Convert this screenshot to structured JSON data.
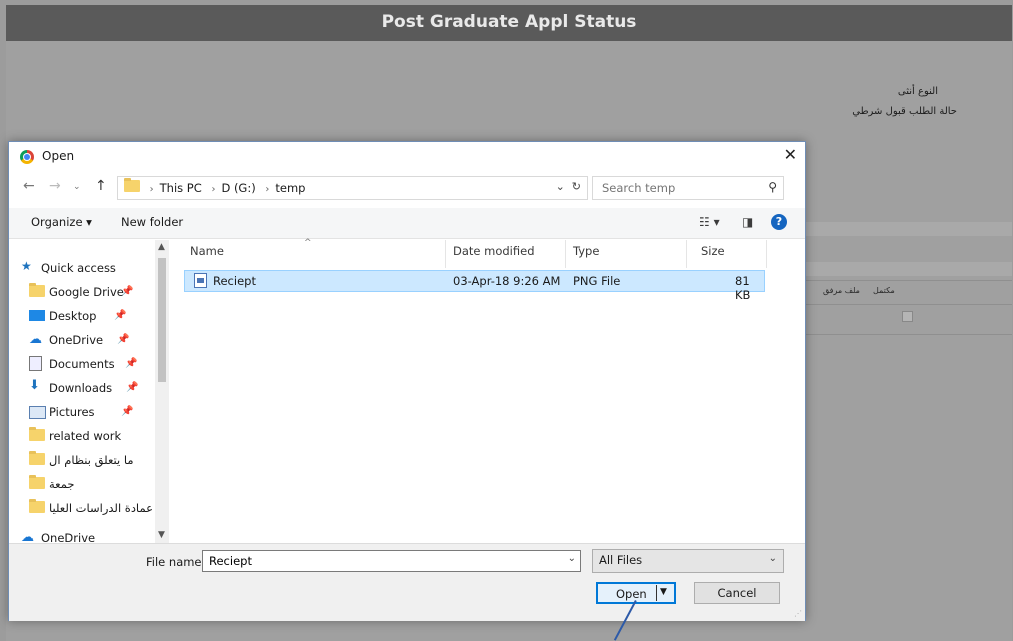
{
  "page": {
    "header_title": "Post Graduate Appl Status",
    "label_gender": "النوع أنثى",
    "label_request_status": "حالة الطلب قبول شرطي",
    "col_attached_file": "ملف مرفق",
    "col_complete": "مكتمل"
  },
  "dialog": {
    "title": "Open",
    "close_symbol": "✕",
    "breadcrumbs": [
      "This PC",
      "D (G:)",
      "temp"
    ],
    "search_placeholder": "Search temp",
    "toolbar": {
      "organize_label": "Organize ▾",
      "new_folder_label": "New folder",
      "help_symbol": "?"
    },
    "nav": {
      "quick_access": "Quick access",
      "items": [
        {
          "label": "Google Drive",
          "icon": "folder-icon",
          "pinned": true
        },
        {
          "label": "Desktop",
          "icon": "desktop-icon",
          "pinned": true
        },
        {
          "label": "OneDrive",
          "icon": "onedrive-icon",
          "pinned": true
        },
        {
          "label": "Documents",
          "icon": "documents-icon",
          "pinned": true
        },
        {
          "label": "Downloads",
          "icon": "downloads-icon",
          "pinned": true
        },
        {
          "label": "Pictures",
          "icon": "pictures-icon",
          "pinned": true
        },
        {
          "label": "related work",
          "icon": "folder-icon",
          "pinned": false
        },
        {
          "label": "ما يتعلق بنظام ال",
          "icon": "folder-icon",
          "pinned": false
        },
        {
          "label": "جمعة",
          "icon": "folder-icon",
          "pinned": false
        },
        {
          "label": "عمادة الدراسات العليا",
          "icon": "folder-icon",
          "pinned": false
        },
        {
          "label": "OneDrive",
          "icon": "onedrive-icon",
          "pinned": false
        }
      ]
    },
    "columns": {
      "name": "Name",
      "date": "Date modified",
      "type": "Type",
      "size": "Size"
    },
    "files": [
      {
        "name": "Reciept",
        "date": "03-Apr-18 9:26 AM",
        "type": "PNG File",
        "size": "81 KB"
      }
    ],
    "file_name_label": "File name:",
    "file_name_value": "Reciept",
    "file_type_value": "All Files",
    "open_label": "Open",
    "cancel_label": "Cancel"
  }
}
